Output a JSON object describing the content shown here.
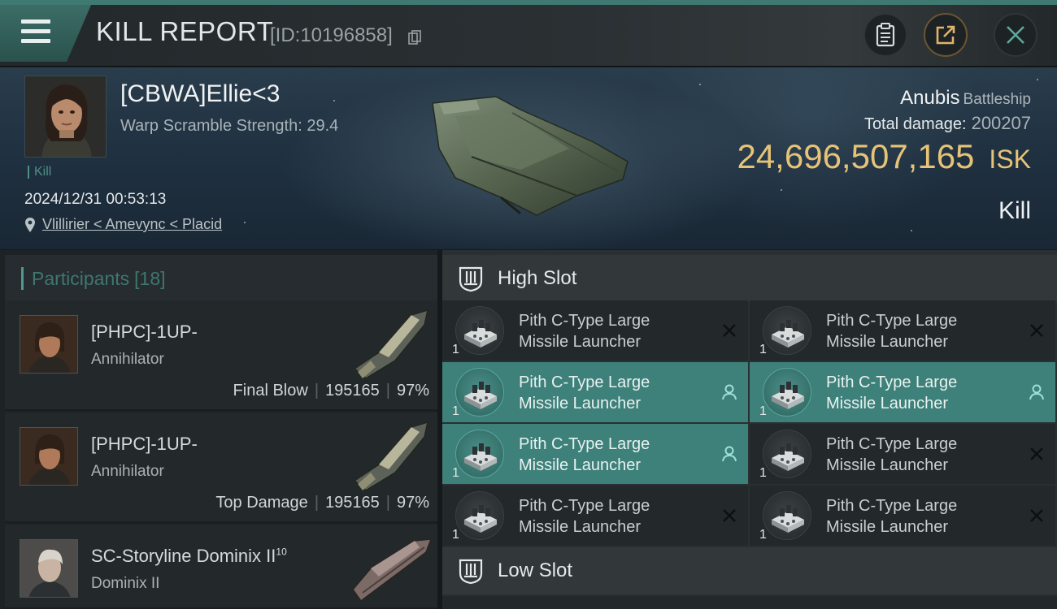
{
  "header": {
    "title": "KILL REPORT",
    "report_id": "[ID:10196858]"
  },
  "victim": {
    "name": "[CBWA]Ellie<3",
    "warp_scramble": "Warp Scramble Strength: 29.4",
    "tag": "Kill",
    "datetime": "2024/12/31 00:53:13",
    "location": "Vlillirier < Amevync < Placid"
  },
  "ship": {
    "name": "Anubis",
    "class": "Battleship",
    "total_damage_label": "Total damage:",
    "total_damage": "200207",
    "isk_value": "24,696,507,165",
    "isk_unit": "ISK",
    "result": "Kill"
  },
  "participants": {
    "label": "Participants",
    "count": "[18]",
    "rows": [
      {
        "name": "[PHPC]-1UP-",
        "ship": "Annihilator",
        "role": "Final Blow",
        "damage": "195165",
        "percent": "97%"
      },
      {
        "name": "[PHPC]-1UP-",
        "ship": "Annihilator",
        "role": "Top Damage",
        "damage": "195165",
        "percent": "97%"
      },
      {
        "name": "SC-Storyline Dominix II",
        "name_sup": "10",
        "ship": "Dominix II"
      }
    ]
  },
  "slots": {
    "high_label": "High Slot",
    "low_label": "Low Slot",
    "high_items": [
      {
        "line1": "Pith C-Type Large",
        "line2": "Missile Launcher",
        "qty": "1",
        "status": "destroyed"
      },
      {
        "line1": "Pith C-Type Large",
        "line2": "Missile Launcher",
        "qty": "1",
        "status": "destroyed"
      },
      {
        "line1": "Pith C-Type Large",
        "line2": "Missile Launcher",
        "qty": "1",
        "status": "dropped"
      },
      {
        "line1": "Pith C-Type Large",
        "line2": "Missile Launcher",
        "qty": "1",
        "status": "dropped"
      },
      {
        "line1": "Pith C-Type Large",
        "line2": "Missile Launcher",
        "qty": "1",
        "status": "dropped"
      },
      {
        "line1": "Pith C-Type Large",
        "line2": "Missile Launcher",
        "qty": "1",
        "status": "destroyed"
      },
      {
        "line1": "Pith C-Type Large",
        "line2": "Missile Launcher",
        "qty": "1",
        "status": "destroyed"
      },
      {
        "line1": "Pith C-Type Large",
        "line2": "Missile Launcher",
        "qty": "1",
        "status": "destroyed"
      }
    ]
  },
  "colors": {
    "accent": "#3e807a",
    "isk": "#e6c377",
    "background": "#15191b"
  }
}
